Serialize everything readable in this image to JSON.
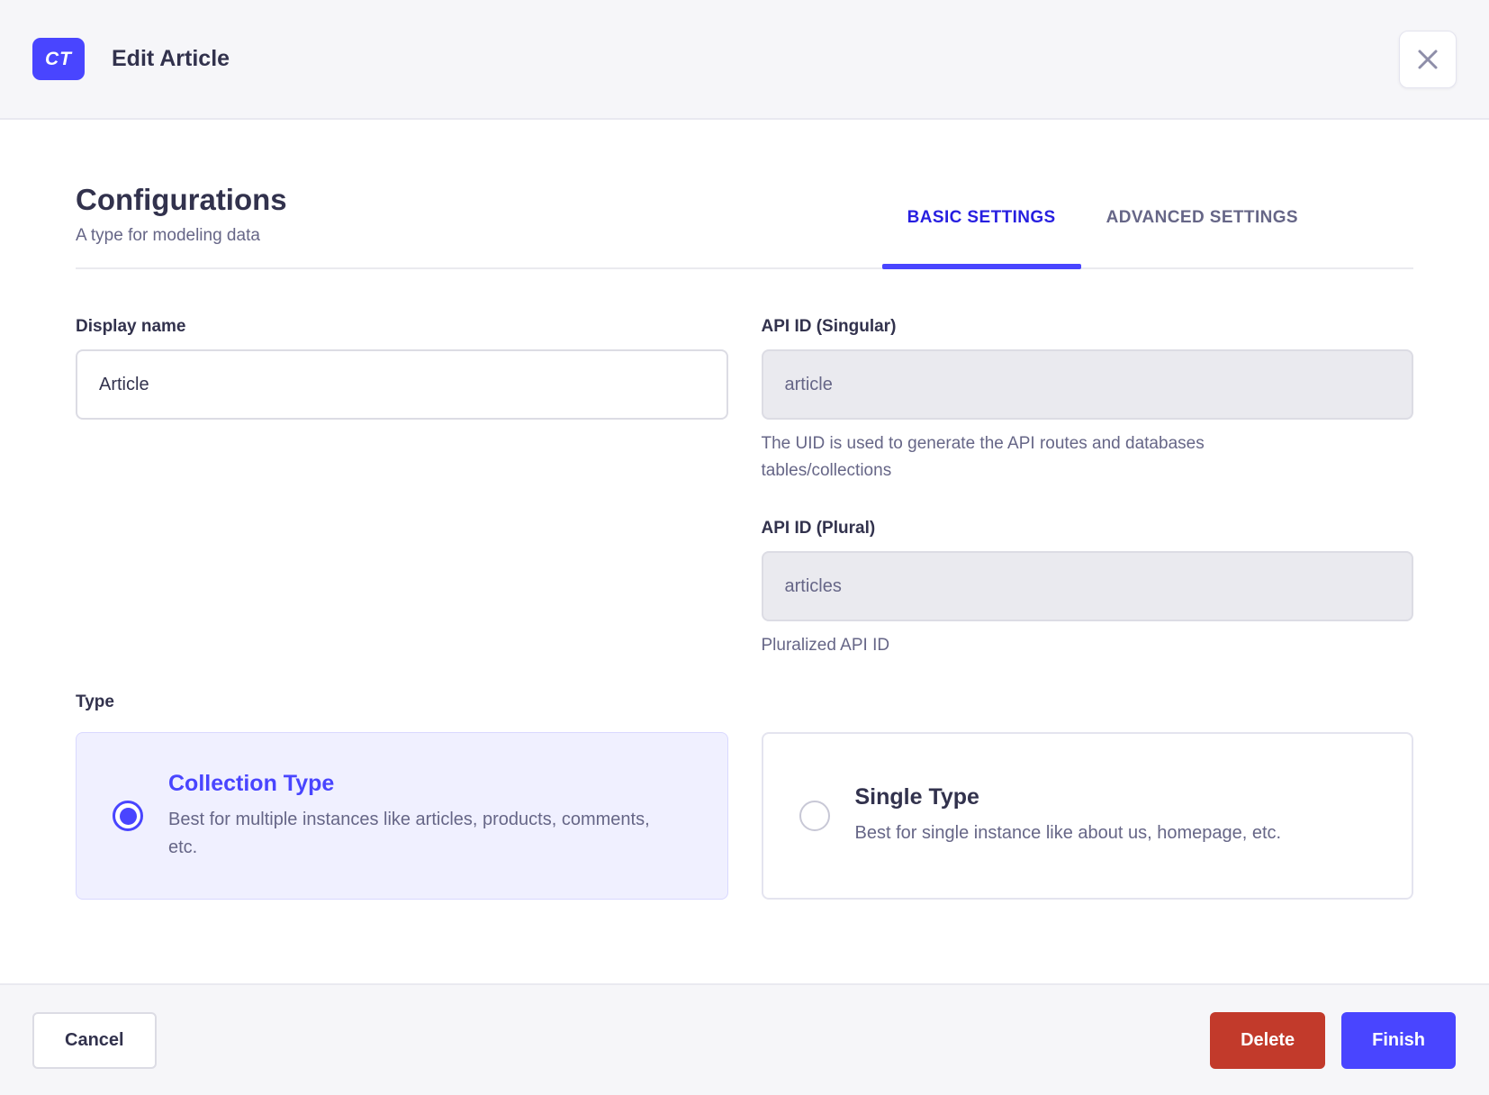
{
  "header": {
    "badge": "CT",
    "title": "Edit Article"
  },
  "section": {
    "title": "Configurations",
    "subtitle": "A type for modeling data"
  },
  "tabs": [
    {
      "label": "BASIC SETTINGS",
      "active": true
    },
    {
      "label": "ADVANCED SETTINGS",
      "active": false
    }
  ],
  "fields": {
    "display_name": {
      "label": "Display name",
      "value": "Article"
    },
    "api_id_singular": {
      "label": "API ID (Singular)",
      "value": "article",
      "disabled": true,
      "hint": "The UID is used to generate the API routes and databases tables/collections"
    },
    "api_id_plural": {
      "label": "API ID (Plural)",
      "value": "articles",
      "disabled": true,
      "hint": "Pluralized API ID"
    }
  },
  "type_section": {
    "label": "Type",
    "options": [
      {
        "title": "Collection Type",
        "description": "Best for multiple instances like articles, products, comments, etc.",
        "selected": true
      },
      {
        "title": "Single Type",
        "description": "Best for single instance like about us, homepage, etc.",
        "selected": false
      }
    ]
  },
  "footer": {
    "cancel_label": "Cancel",
    "delete_label": "Delete",
    "finish_label": "Finish"
  },
  "icons": {
    "close": "close-icon",
    "radio_checked": "radio-checked-icon",
    "radio_unchecked": "radio-unchecked-icon"
  },
  "colors": {
    "primary": "#4945FF",
    "active_tab_text": "#271FE0",
    "danger": "#C23A2B",
    "header_footer_bg": "#F6F6F9",
    "selected_card_bg": "#F0F0FF",
    "text_dark": "#32324D",
    "text_muted": "#666687"
  }
}
